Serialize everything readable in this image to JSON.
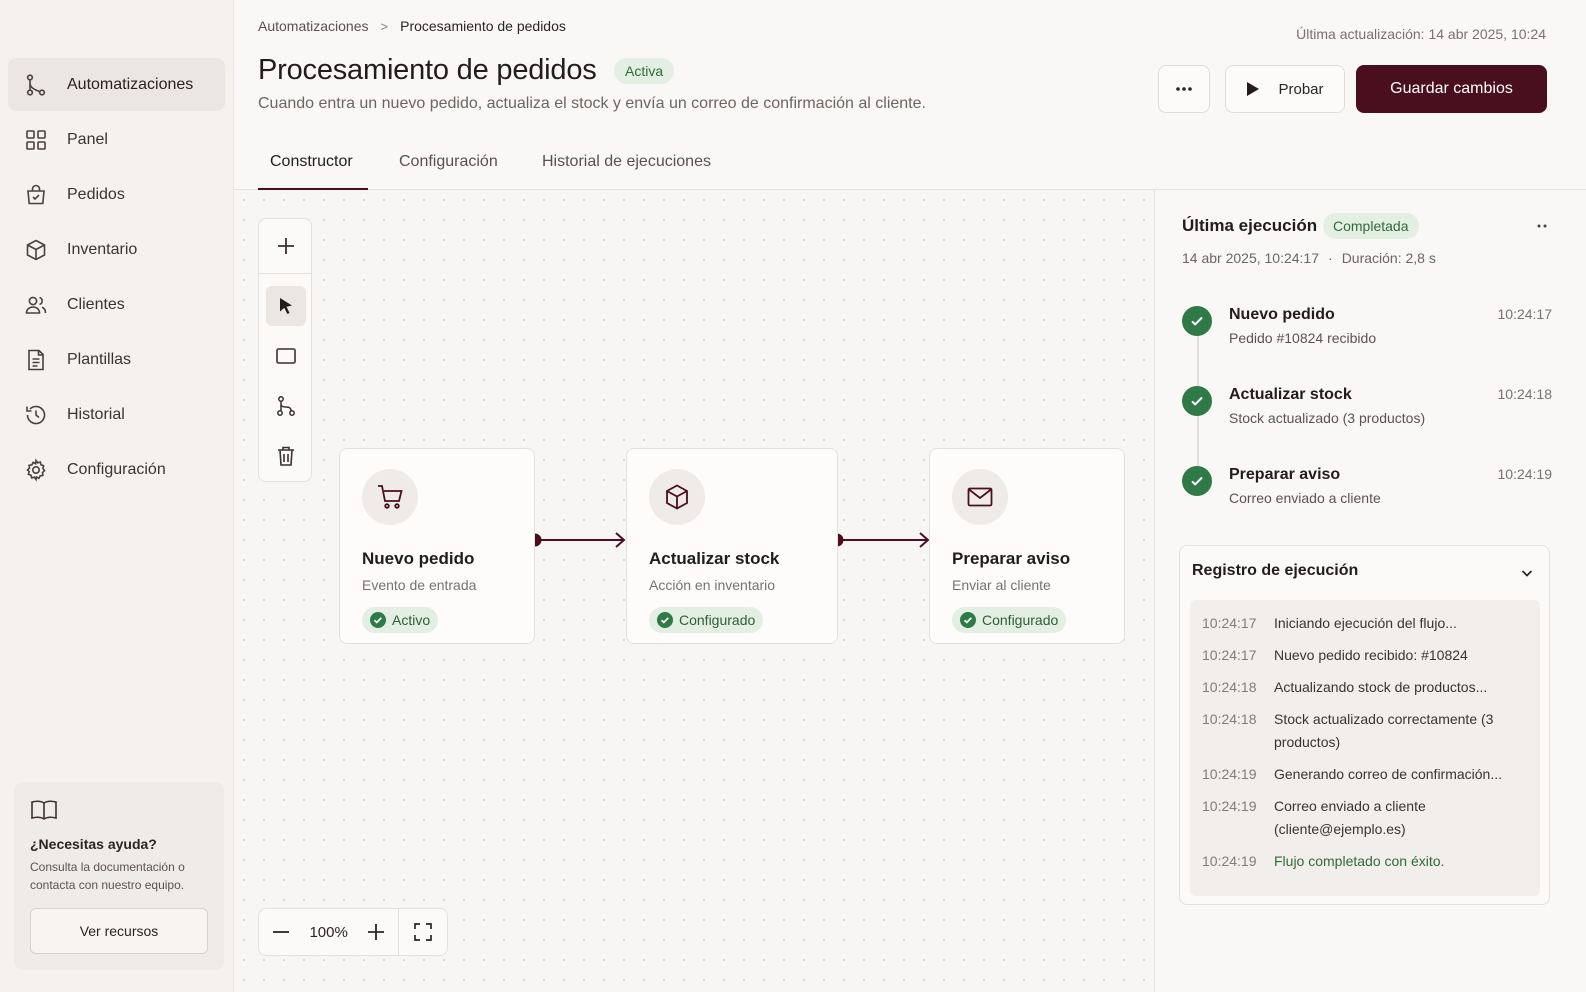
{
  "sidebar": {
    "items": [
      {
        "label": "Automatizaciones",
        "icon": "workflow-icon",
        "active": true
      },
      {
        "label": "Panel",
        "icon": "grid-icon"
      },
      {
        "label": "Pedidos",
        "icon": "shopping-bag-icon"
      },
      {
        "label": "Inventario",
        "icon": "box-icon"
      },
      {
        "label": "Clientes",
        "icon": "users-icon"
      },
      {
        "label": "Plantillas",
        "icon": "document-icon"
      },
      {
        "label": "Historial",
        "icon": "history-icon"
      },
      {
        "label": "Configuración",
        "icon": "gear-icon"
      }
    ],
    "help": {
      "icon": "book-icon",
      "title": "¿Necesitas ayuda?",
      "text": "Consulta la documentación o contacta con nuestro equipo.",
      "button": "Ver recursos"
    }
  },
  "header": {
    "breadcrumb": [
      "Automatizaciones",
      "Procesamiento de pedidos"
    ],
    "last_update": "Última actualización: 14 abr 2025, 10:24",
    "title": "Procesamiento de pedidos",
    "status": "Activa",
    "description": "Cuando entra un nuevo pedido, actualiza el stock y envía un correo de confirmación al cliente.",
    "test_label": "Probar",
    "save_label": "Guardar cambios"
  },
  "tabs": [
    {
      "label": "Constructor",
      "active": true
    },
    {
      "label": "Configuración"
    },
    {
      "label": "Historial de ejecuciones"
    }
  ],
  "canvas": {
    "tools": [
      "plus-icon",
      "pointer-icon",
      "rectangle-icon",
      "branch-icon",
      "trash-icon"
    ],
    "nodes": [
      {
        "title": "Nuevo pedido",
        "subtitle": "Evento de entrada",
        "badge": "Activo",
        "icon": "cart-icon"
      },
      {
        "title": "Actualizar stock",
        "subtitle": "Acción en inventario",
        "badge": "Configurado",
        "icon": "box-icon"
      },
      {
        "title": "Preparar aviso",
        "subtitle": "Enviar al cliente",
        "badge": "Configurado",
        "icon": "mail-icon"
      }
    ],
    "zoom": "100%"
  },
  "panel": {
    "title": "Última ejecución",
    "status": "Completada",
    "date": "14 abr 2025, 10:24:17",
    "separator": "·",
    "duration": "Duración: 2,8 s",
    "steps": [
      {
        "title": "Nuevo pedido",
        "subtitle": "Pedido #10824 recibido",
        "time": "10:24:17"
      },
      {
        "title": "Actualizar stock",
        "subtitle": "Stock actualizado (3 productos)",
        "time": "10:24:18"
      },
      {
        "title": "Preparar aviso",
        "subtitle": "Correo enviado a cliente",
        "time": "10:24:19"
      }
    ],
    "log": {
      "title": "Registro de ejecución",
      "rows": [
        {
          "time": "10:24:17",
          "msg": "Iniciando ejecución del flujo..."
        },
        {
          "time": "10:24:17",
          "msg": "Nuevo pedido recibido: #10824"
        },
        {
          "time": "10:24:18",
          "msg": "Actualizando stock de productos..."
        },
        {
          "time": "10:24:18",
          "msg": "Stock actualizado correctamente (3 productos)"
        },
        {
          "time": "10:24:19",
          "msg": "Generando correo de confirmación..."
        },
        {
          "time": "10:24:19",
          "msg": "Correo enviado a cliente (cliente@ejemplo.es)"
        },
        {
          "time": "10:24:19",
          "msg": "Flujo completado con éxito."
        }
      ]
    }
  },
  "colors": {
    "brand": "#4a0f1f",
    "success": "#2f7a47",
    "success_bg": "#e3efe2"
  }
}
